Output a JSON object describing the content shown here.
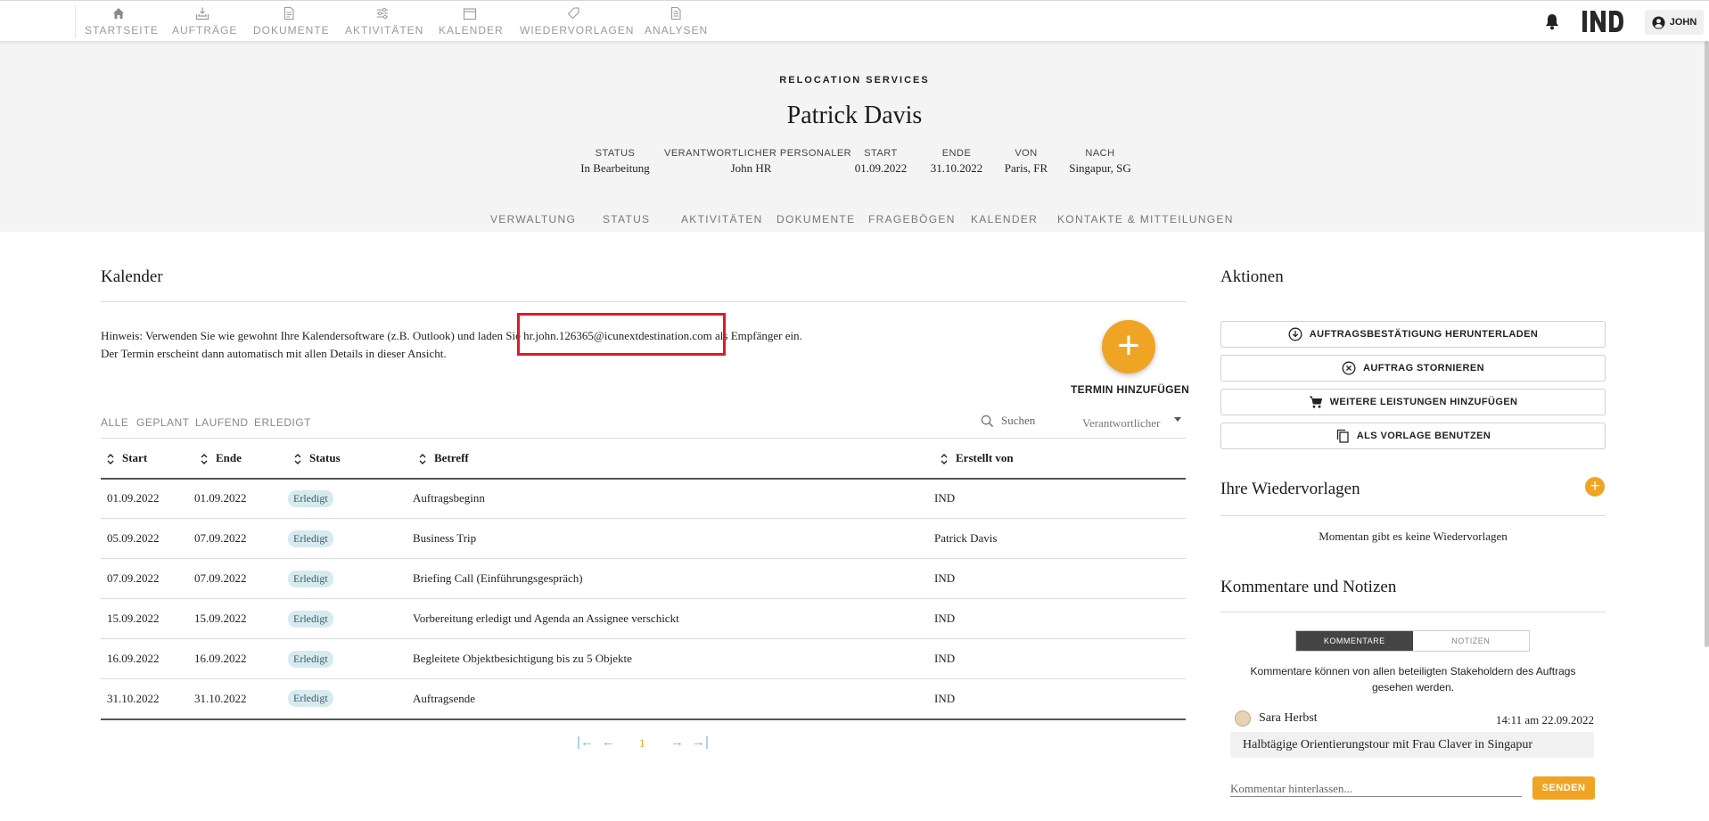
{
  "nav": {
    "items": [
      {
        "label": "STARTSEITE",
        "icon": "home-icon"
      },
      {
        "label": "AUFTRÄGE",
        "icon": "orders-icon"
      },
      {
        "label": "DOKUMENTE",
        "icon": "document-icon"
      },
      {
        "label": "AKTIVITÄTEN",
        "icon": "sliders-icon"
      },
      {
        "label": "KALENDER",
        "icon": "calendar-icon"
      },
      {
        "label": "WIEDERVORLAGEN",
        "icon": "tag-icon"
      },
      {
        "label": "ANALYSEN",
        "icon": "report-icon"
      }
    ],
    "logo_text": "IND",
    "user_label": "JOHN"
  },
  "header": {
    "eyebrow": "RELOCATION SERVICES",
    "name": "Patrick Davis",
    "meta": [
      {
        "key": "STATUS",
        "value": "In Bearbeitung"
      },
      {
        "key": "VERANTWORTLICHER PERSONALER",
        "value": "John HR"
      },
      {
        "key": "START",
        "value": "01.09.2022"
      },
      {
        "key": "ENDE",
        "value": "31.10.2022"
      },
      {
        "key": "VON",
        "value": "Paris, FR"
      },
      {
        "key": "NACH",
        "value": "Singapur, SG"
      }
    ],
    "tabs": [
      "VERWALTUNG",
      "STATUS",
      "AKTIVITÄTEN",
      "DOKUMENTE",
      "FRAGEBÖGEN",
      "KALENDER",
      "KONTAKTE & MITTEILUNGEN"
    ]
  },
  "calendar": {
    "title": "Kalender",
    "hint_before": "Hinweis: Verwenden Sie wie gewohnt Ihre Kalendersoftware (z.B. Outlook) und laden Sie ",
    "hint_email": "hr.john.126365@icunextdestination.com",
    "hint_after": " als Empfänger ein.",
    "hint_line2": "Der Termin erscheint dann automatisch mit allen Details in dieser Ansicht.",
    "add_label": "TERMIN HINZUFÜGEN",
    "add_symbol": "+",
    "filters": [
      "ALLE",
      "GEPLANT",
      "LAUFEND",
      "ERLEDIGT"
    ],
    "search_placeholder": "Suchen",
    "responsible_placeholder": "Verantwortlicher",
    "columns": [
      "Start",
      "Ende",
      "Status",
      "Betreff",
      "Erstellt von"
    ],
    "rows": [
      {
        "start": "01.09.2022",
        "end": "01.09.2022",
        "status": "Erledigt",
        "subject": "Auftragsbeginn",
        "creator": "IND"
      },
      {
        "start": "05.09.2022",
        "end": "07.09.2022",
        "status": "Erledigt",
        "subject": "Business Trip",
        "creator": "Patrick Davis"
      },
      {
        "start": "07.09.2022",
        "end": "07.09.2022",
        "status": "Erledigt",
        "subject": "Briefing Call (Einführungsgespräch)",
        "creator": "IND"
      },
      {
        "start": "15.09.2022",
        "end": "15.09.2022",
        "status": "Erledigt",
        "subject": "Vorbereitung erledigt und Agenda an Assignee verschickt",
        "creator": "IND"
      },
      {
        "start": "16.09.2022",
        "end": "16.09.2022",
        "status": "Erledigt",
        "subject": "Begleitete Objektbesichtigung bis zu 5 Objekte",
        "creator": "IND"
      },
      {
        "start": "31.10.2022",
        "end": "31.10.2022",
        "status": "Erledigt",
        "subject": "Auftragsende",
        "creator": "IND"
      }
    ],
    "pager": {
      "first": "|←",
      "prev": "←",
      "page": "1",
      "next": "→",
      "last": "→|"
    }
  },
  "actions": {
    "title": "Aktionen",
    "buttons": [
      {
        "label": "AUFTRAGSBESTÄTIGUNG HERUNTERLADEN",
        "icon": "download-circle-icon"
      },
      {
        "label": "AUFTRAG STORNIEREN",
        "icon": "cancel-circle-icon"
      },
      {
        "label": "WEITERE LEISTUNGEN HINZUFÜGEN",
        "icon": "cart-icon"
      },
      {
        "label": "ALS VORLAGE BENUTZEN",
        "icon": "copy-icon"
      }
    ]
  },
  "reminders": {
    "title": "Ihre Wiedervorlagen",
    "add_symbol": "+",
    "empty_text": "Momentan gibt es keine Wiedervorlagen"
  },
  "comments": {
    "title": "Kommentare und Notizen",
    "tabs": [
      "KOMMENTARE",
      "NOTIZEN"
    ],
    "info": "Kommentare können von allen beteiligten Stakeholdern des Auftrags gesehen werden.",
    "items": [
      {
        "author": "Sara Herbst",
        "time": "14:11 am 22.09.2022",
        "text": "Halbtägige Orientierungstour mit Frau Claver in Singapur"
      }
    ],
    "input_placeholder": "Kommentar hinterlassen...",
    "send_label": "SENDEN"
  },
  "colors": {
    "accent": "#f0a424",
    "badge_bg": "#d7eaf0",
    "highlight": "#e0192b",
    "hero_bg": "#f4f4f4"
  }
}
